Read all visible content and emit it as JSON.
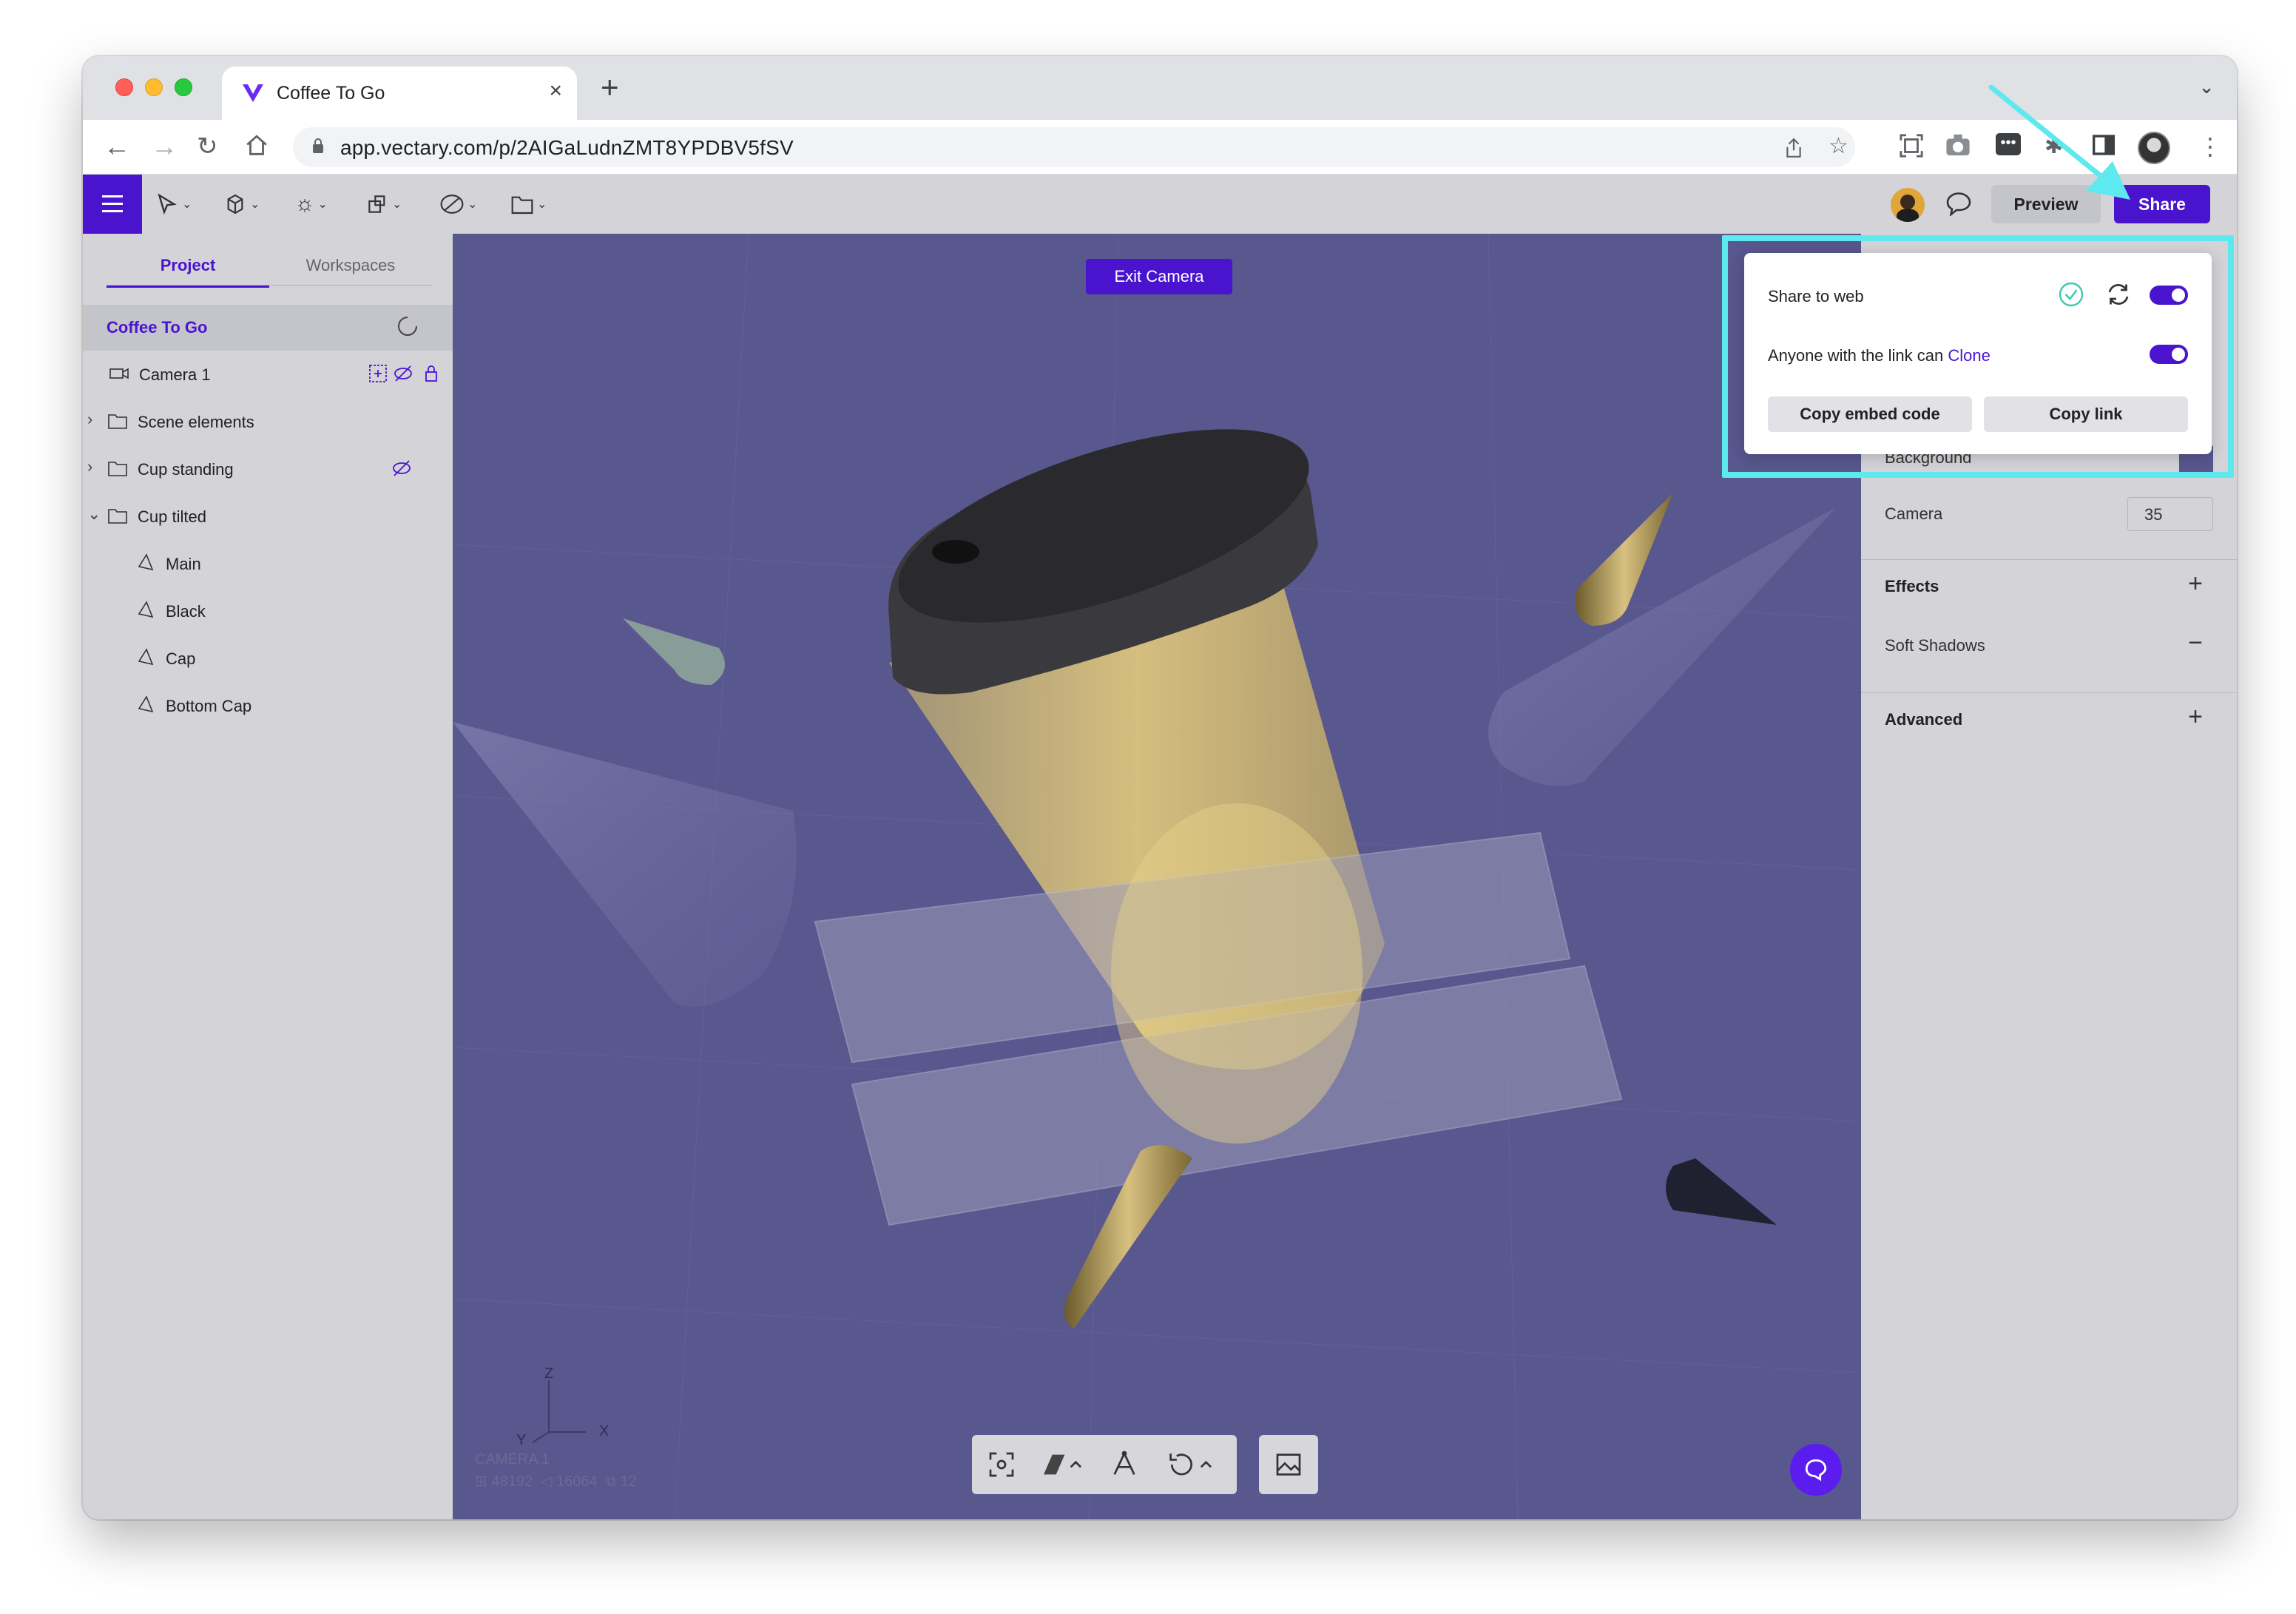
{
  "browser": {
    "tab_title": "Coffee To Go",
    "tab_close": "×",
    "new_tab": "+",
    "url": "app.vectary.com/p/2AIGaLudnZMT8YPDBV5fSV"
  },
  "toolbar": {
    "preview_label": "Preview",
    "share_label": "Share"
  },
  "left_panel": {
    "tabs": [
      "Project",
      "Workspaces"
    ],
    "items": [
      {
        "label": "Coffee To Go"
      },
      {
        "label": "Camera 1"
      },
      {
        "label": "Scene elements"
      },
      {
        "label": "Cup standing"
      },
      {
        "label": "Cup tilted"
      },
      {
        "label": "Main"
      },
      {
        "label": "Black"
      },
      {
        "label": "Cap"
      },
      {
        "label": "Bottom Cap"
      }
    ]
  },
  "viewport": {
    "exit_camera_label": "Exit Camera",
    "axes": {
      "z": "Z",
      "y": "Y",
      "x": "X"
    },
    "camera_name": "CAMERA 1",
    "stats": {
      "vertices": "48192",
      "edges": "16064",
      "objects": "12"
    }
  },
  "share_popover": {
    "share_to_web": "Share to web",
    "link_text": "Anyone with the link can",
    "link_permission": "Clone",
    "copy_embed": "Copy embed code",
    "copy_link": "Copy link",
    "share_to_web_on": true,
    "clone_on": true
  },
  "right_panel": {
    "background_label": "Background",
    "camera_label": "Camera",
    "camera_value": "35",
    "effects_label": "Effects",
    "soft_shadows_label": "Soft Shadows",
    "advanced_label": "Advanced",
    "plus": "+",
    "minus": "−"
  },
  "colors": {
    "accent": "#4a14cf",
    "viewport_bg": "#58578e",
    "highlight": "#5ee9ef",
    "panel_bg": "#d3d3d8"
  }
}
